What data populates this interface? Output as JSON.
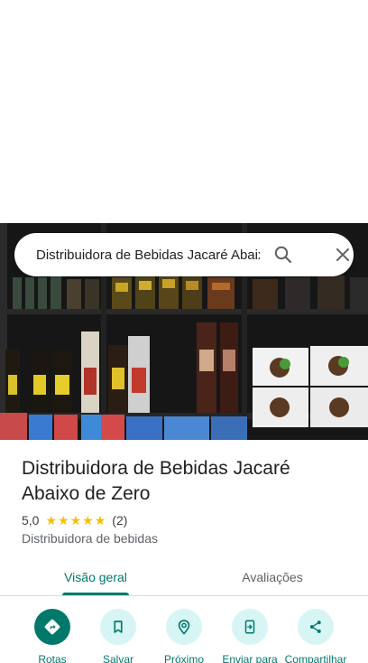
{
  "search": {
    "query": "Distribuidora de Bebidas Jacaré Abaixo de Zero"
  },
  "place": {
    "name": "Distribuidora de Bebidas Jacaré Abaixo de Zero",
    "rating": "5,0",
    "stars": 5,
    "review_count": "(2)",
    "category": "Distribuidora de bebidas"
  },
  "tabs": [
    {
      "label": "Visão geral",
      "active": true
    },
    {
      "label": "Avaliações",
      "active": false
    }
  ],
  "actions": [
    {
      "label": "Rotas",
      "icon": "directions-icon"
    },
    {
      "label": "Salvar",
      "icon": "bookmark-icon"
    },
    {
      "label": "Próximo",
      "icon": "nearby-icon"
    },
    {
      "label": "Enviar para",
      "icon": "send-to-phone-icon"
    },
    {
      "label": "Compartilhar",
      "icon": "share-icon"
    }
  ],
  "colors": {
    "accent": "#00796b",
    "star": "#fbbc04",
    "action_bg": "#d7f5f5"
  }
}
